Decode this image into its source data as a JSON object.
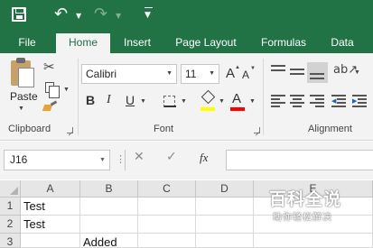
{
  "quick_access": {
    "save_icon": "save-icon",
    "undo_icon": "undo-icon",
    "redo_icon": "redo-icon",
    "customize_icon": "customize-toolbar-icon"
  },
  "tabs": [
    "File",
    "Home",
    "Insert",
    "Page Layout",
    "Formulas",
    "Data"
  ],
  "active_tab": "Home",
  "ribbon": {
    "clipboard": {
      "paste_label": "Paste",
      "group_label": "Clipboard"
    },
    "font": {
      "font_name": "Calibri",
      "font_size": "11",
      "grow_label": "A",
      "shrink_label": "A",
      "bold_label": "B",
      "italic_label": "I",
      "underline_label": "U",
      "font_color_label": "A",
      "fill_color": "#ffff00",
      "font_color": "#ff0000",
      "group_label": "Font"
    },
    "alignment": {
      "group_label": "Alignment"
    }
  },
  "formula_bar": {
    "name_box": "J16",
    "cancel_glyph": "✕",
    "enter_glyph": "✓",
    "fx_label": "fx",
    "formula_value": ""
  },
  "grid": {
    "columns": [
      "A",
      "B",
      "C",
      "D",
      "E"
    ],
    "rows": [
      {
        "number": "1",
        "cells": [
          "Test",
          "",
          "",
          "",
          ""
        ]
      },
      {
        "number": "2",
        "cells": [
          "Test",
          "",
          "",
          "",
          ""
        ]
      },
      {
        "number": "3",
        "cells": [
          "",
          "Added",
          "",
          "",
          ""
        ]
      }
    ]
  },
  "watermark": {
    "title": "百科全说",
    "subtitle": "助你轻松解决"
  },
  "colors": {
    "excel_green": "#217346",
    "ribbon_bg": "#f3f3f3"
  }
}
